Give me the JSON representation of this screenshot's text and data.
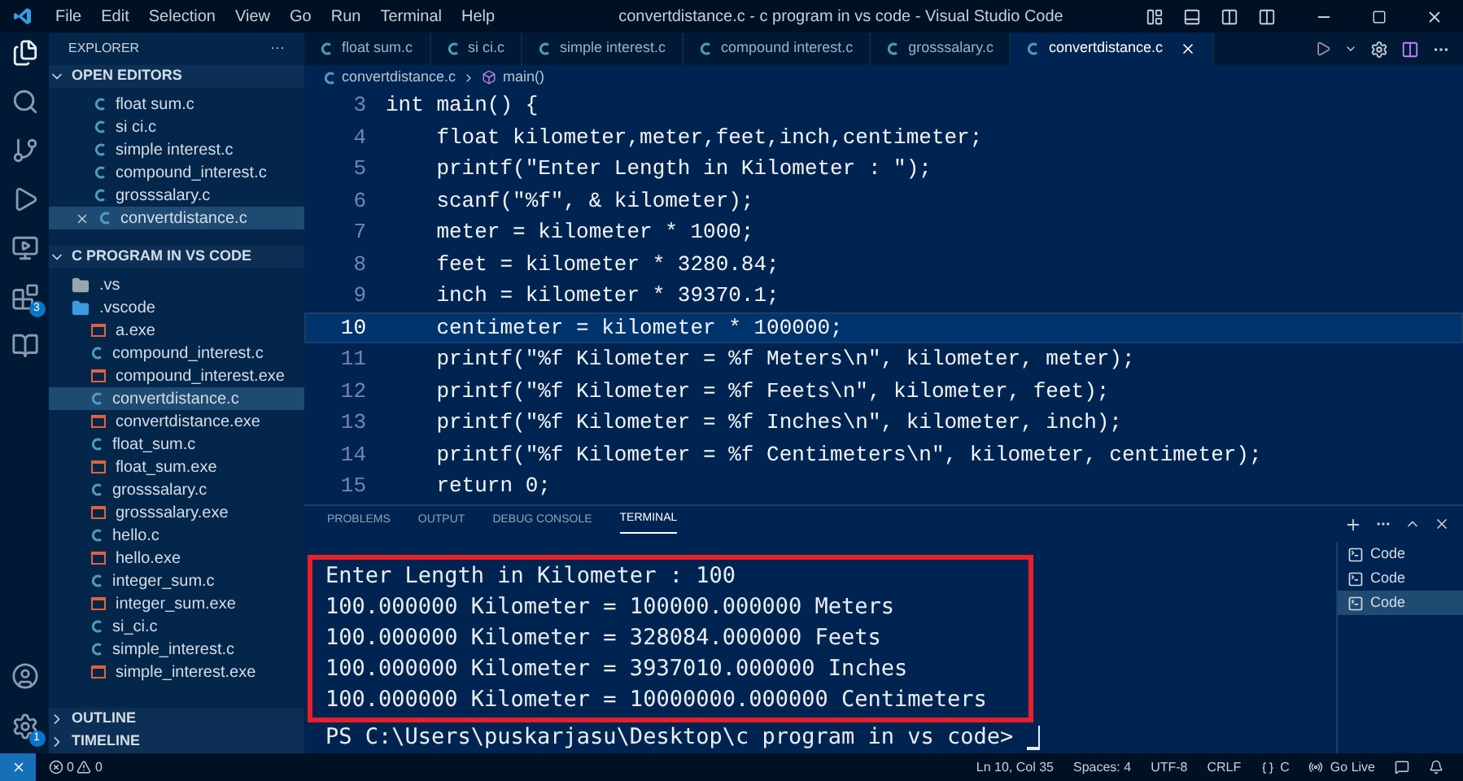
{
  "window": {
    "title": "convertdistance.c - c program in vs code - Visual Studio Code",
    "menu": [
      "File",
      "Edit",
      "Selection",
      "View",
      "Go",
      "Run",
      "Terminal",
      "Help"
    ]
  },
  "activity_bar": {
    "extensions_badge": "3",
    "settings_badge": "1"
  },
  "sidebar": {
    "title": "EXPLORER",
    "more": "···",
    "open_editors": {
      "title": "OPEN EDITORS",
      "expanded": true,
      "items": [
        {
          "name": "float sum.c",
          "kind": "c",
          "selected": false
        },
        {
          "name": "si ci.c",
          "kind": "c",
          "selected": false
        },
        {
          "name": "simple interest.c",
          "kind": "c",
          "selected": false
        },
        {
          "name": "compound_interest.c",
          "kind": "c",
          "selected": false
        },
        {
          "name": "grosssalary.c",
          "kind": "c",
          "selected": false
        },
        {
          "name": "convertdistance.c",
          "kind": "c",
          "selected": true
        }
      ]
    },
    "folder": {
      "title": "C PROGRAM IN VS CODE",
      "expanded": true,
      "items": [
        {
          "name": ".vs",
          "kind": "folder",
          "selected": false
        },
        {
          "name": ".vscode",
          "kind": "vscode",
          "selected": false
        },
        {
          "name": "a.exe",
          "kind": "exe",
          "selected": false
        },
        {
          "name": "compound_interest.c",
          "kind": "c",
          "selected": false
        },
        {
          "name": "compound_interest.exe",
          "kind": "exe",
          "selected": false
        },
        {
          "name": "convertdistance.c",
          "kind": "c",
          "selected": true
        },
        {
          "name": "convertdistance.exe",
          "kind": "exe",
          "selected": false
        },
        {
          "name": "float_sum.c",
          "kind": "c",
          "selected": false
        },
        {
          "name": "float_sum.exe",
          "kind": "exe",
          "selected": false
        },
        {
          "name": "grosssalary.c",
          "kind": "c",
          "selected": false
        },
        {
          "name": "grosssalary.exe",
          "kind": "exe",
          "selected": false
        },
        {
          "name": "hello.c",
          "kind": "c",
          "selected": false
        },
        {
          "name": "hello.exe",
          "kind": "exe",
          "selected": false
        },
        {
          "name": "integer_sum.c",
          "kind": "c",
          "selected": false
        },
        {
          "name": "integer_sum.exe",
          "kind": "exe",
          "selected": false
        },
        {
          "name": "si_ci.c",
          "kind": "c",
          "selected": false
        },
        {
          "name": "simple_interest.c",
          "kind": "c",
          "selected": false
        },
        {
          "name": "simple_interest.exe",
          "kind": "exe",
          "selected": false
        }
      ]
    },
    "sections": [
      {
        "title": "OUTLINE",
        "expanded": false
      },
      {
        "title": "TIMELINE",
        "expanded": false
      }
    ]
  },
  "tabs": [
    {
      "label": "float sum.c",
      "selected": false
    },
    {
      "label": "si ci.c",
      "selected": false
    },
    {
      "label": "simple interest.c",
      "selected": false
    },
    {
      "label": "compound interest.c",
      "selected": false
    },
    {
      "label": "grosssalary.c",
      "selected": false
    },
    {
      "label": "convertdistance.c",
      "selected": true
    }
  ],
  "breadcrumb": [
    "convertdistance.c",
    "main()"
  ],
  "editor": {
    "lines": [
      {
        "number": "3",
        "text": "int main() {",
        "selected": false
      },
      {
        "number": "4",
        "text": "    float kilometer,meter,feet,inch,centimeter;",
        "selected": false
      },
      {
        "number": "5",
        "text": "    printf(\"Enter Length in Kilometer : \");",
        "selected": false
      },
      {
        "number": "6",
        "text": "    scanf(\"%f\", & kilometer);",
        "selected": false
      },
      {
        "number": "7",
        "text": "    meter = kilometer * 1000;",
        "selected": false
      },
      {
        "number": "8",
        "text": "    feet = kilometer * 3280.84;",
        "selected": false
      },
      {
        "number": "9",
        "text": "    inch = kilometer * 39370.1;",
        "selected": false
      },
      {
        "number": "10",
        "text": "    centimeter = kilometer * 100000;",
        "selected": true
      },
      {
        "number": "11",
        "text": "    printf(\"%f Kilometer = %f Meters\\n\", kilometer, meter);",
        "selected": false
      },
      {
        "number": "12",
        "text": "    printf(\"%f Kilometer = %f Feets\\n\", kilometer, feet);",
        "selected": false
      },
      {
        "number": "13",
        "text": "    printf(\"%f Kilometer = %f Inches\\n\", kilometer, inch);",
        "selected": false
      },
      {
        "number": "14",
        "text": "    printf(\"%f Kilometer = %f Centimeters\\n\", kilometer, centimeter);",
        "selected": false
      },
      {
        "number": "15",
        "text": "    return 0;",
        "selected": false
      }
    ]
  },
  "panel": {
    "tabs": [
      {
        "label": "PROBLEMS",
        "selected": false
      },
      {
        "label": "OUTPUT",
        "selected": false
      },
      {
        "label": "DEBUG CONSOLE",
        "selected": false
      },
      {
        "label": "TERMINAL",
        "selected": true
      }
    ],
    "terminal_output": [
      "Enter Length in Kilometer : 100",
      "100.000000 Kilometer = 100000.000000 Meters",
      "100.000000 Kilometer = 328084.000000 Feets",
      "100.000000 Kilometer = 3937010.000000 Inches",
      "100.000000 Kilometer = 10000000.000000 Centimeters"
    ],
    "prompt": "PS C:\\Users\\puskarjasu\\Desktop\\c program in vs code> ",
    "terminals": [
      {
        "label": "Code",
        "selected": false
      },
      {
        "label": "Code",
        "selected": false
      },
      {
        "label": "Code",
        "selected": true
      }
    ]
  },
  "status_bar": {
    "errors": "0",
    "warnings": "0",
    "right": [
      {
        "label": "Ln 10, Col 35",
        "kind": "text"
      },
      {
        "label": "Spaces: 4",
        "kind": "text"
      },
      {
        "label": "UTF-8",
        "kind": "text"
      },
      {
        "label": "CRLF",
        "kind": "text"
      },
      {
        "label": "C",
        "kind": "language"
      },
      {
        "label": "Go Live",
        "kind": "live"
      },
      {
        "kind": "feedback"
      },
      {
        "kind": "bell"
      }
    ]
  }
}
